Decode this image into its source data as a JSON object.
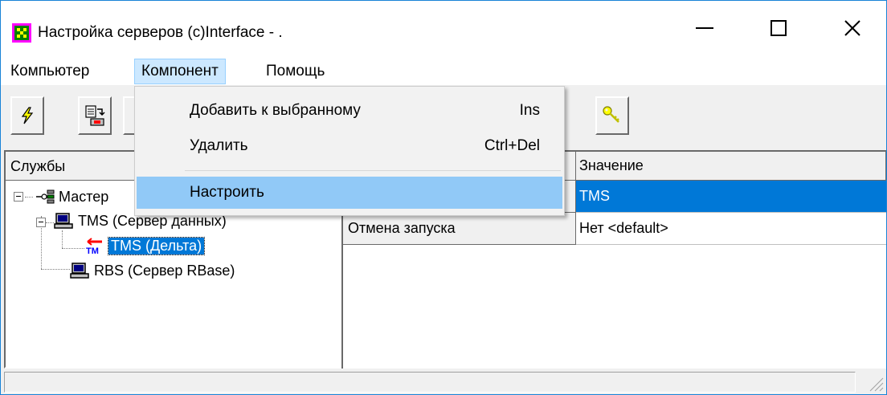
{
  "window": {
    "title": "Настройка серверов (c)Interface - ."
  },
  "menubar": {
    "items": [
      {
        "label": "Компьютер"
      },
      {
        "label": "Компонент"
      },
      {
        "label": "Помощь"
      }
    ]
  },
  "dropdown": {
    "items": [
      {
        "label": "Добавить к выбранному",
        "shortcut": "Ins"
      },
      {
        "label": "Удалить",
        "shortcut": "Ctrl+Del"
      },
      {
        "label": "Настроить",
        "shortcut": ""
      }
    ]
  },
  "tree": {
    "header": "Службы",
    "nodes": [
      {
        "label": "Мастер"
      },
      {
        "label": "TMS (Сервер данных)"
      },
      {
        "label": "TMS (Дельта)"
      },
      {
        "label": "RBS (Сервер RBase)"
      }
    ],
    "delta_icon_text": "TM"
  },
  "properties": {
    "value_header": "Значение",
    "rows": [
      {
        "name": "",
        "value": "TMS"
      },
      {
        "name": "Отмена запуска",
        "value": "Нет <default>"
      }
    ]
  },
  "colors": {
    "selection": "#0078d7",
    "menu_highlight": "#91c9f7",
    "accent_border": "#1883d7"
  },
  "icons": [
    "app-icon",
    "minimize-icon",
    "maximize-icon",
    "close-icon",
    "connect-icon",
    "export-icon",
    "key-icon",
    "network-icon",
    "computer-icon",
    "tm-delta-icon",
    "size-grip-icon"
  ]
}
